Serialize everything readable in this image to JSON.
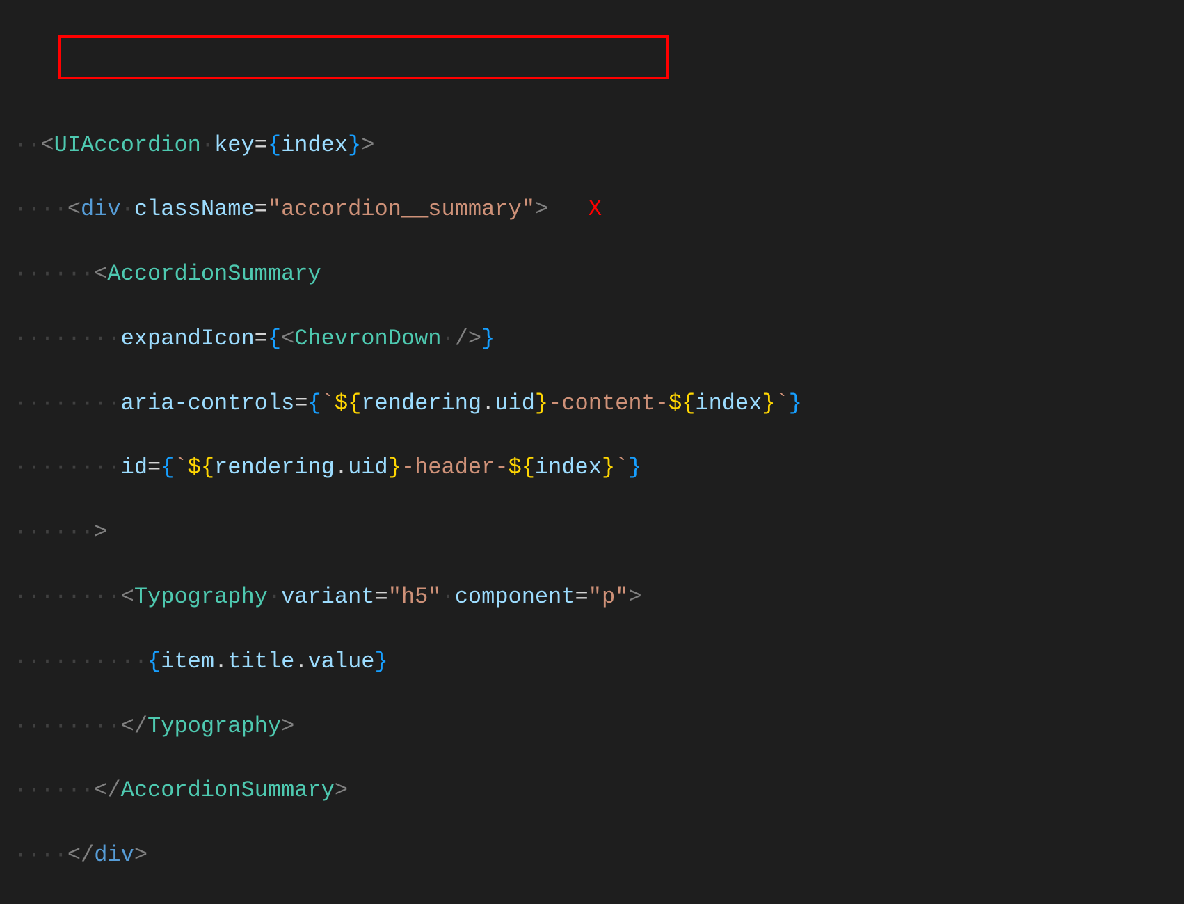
{
  "annotation": {
    "x_mark": "X"
  },
  "code": {
    "l1": {
      "ws": "··",
      "t1": "<",
      "t2": "UIAccordion",
      "t3": "·",
      "t4": "key",
      "t5": "=",
      "t6": "{",
      "t7": "index",
      "t8": "}",
      "t9": ">"
    },
    "l2": {
      "ws": "····",
      "t1": "<",
      "t2": "div",
      "t3": "·",
      "t4": "className",
      "t5": "=",
      "t6": "\"accordion__summary\"",
      "t7": ">"
    },
    "l3": {
      "ws": "······",
      "t1": "<",
      "t2": "AccordionSummary"
    },
    "l4": {
      "ws": "········",
      "t1": "expandIcon",
      "t2": "=",
      "t3": "{",
      "t4": "<",
      "t5": "ChevronDown",
      "t6": "·",
      "t7": "/>",
      "t8": "}"
    },
    "l5": {
      "ws": "········",
      "t1": "aria-controls",
      "t2": "=",
      "t3": "{",
      "t4": "`",
      "t5": "${",
      "t6": "rendering",
      "t7": ".",
      "t8": "uid",
      "t9": "}",
      "t10": "-content-",
      "t11": "${",
      "t12": "index",
      "t13": "}",
      "t14": "`",
      "t15": "}"
    },
    "l6": {
      "ws": "········",
      "t1": "id",
      "t2": "=",
      "t3": "{",
      "t4": "`",
      "t5": "${",
      "t6": "rendering",
      "t7": ".",
      "t8": "uid",
      "t9": "}",
      "t10": "-header-",
      "t11": "${",
      "t12": "index",
      "t13": "}",
      "t14": "`",
      "t15": "}"
    },
    "l7": {
      "ws": "······",
      "t1": ">"
    },
    "l8": {
      "ws": "········",
      "t1": "<",
      "t2": "Typography",
      "t3": "·",
      "t4": "variant",
      "t5": "=",
      "t6": "\"h5\"",
      "t7": "·",
      "t8": "component",
      "t9": "=",
      "t10": "\"p\"",
      "t11": ">"
    },
    "l9": {
      "ws": "··········",
      "t1": "{",
      "t2": "item",
      "t3": ".",
      "t4": "title",
      "t5": ".",
      "t6": "value",
      "t7": "}"
    },
    "l10": {
      "ws": "········",
      "t1": "</",
      "t2": "Typography",
      "t3": ">"
    },
    "l11": {
      "ws": "······",
      "t1": "</",
      "t2": "AccordionSummary",
      "t3": ">"
    },
    "l12": {
      "ws": "····",
      "t1": "</",
      "t2": "div",
      "t3": ">"
    }
  }
}
